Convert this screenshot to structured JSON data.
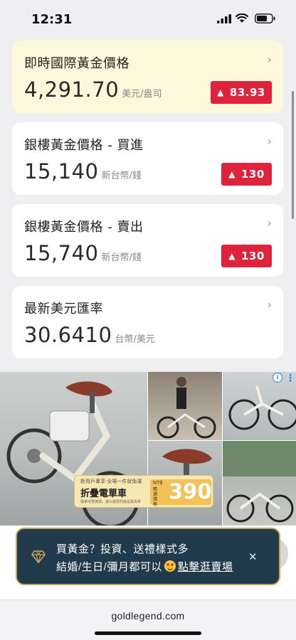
{
  "status_bar": {
    "time": "12:31"
  },
  "cards": [
    {
      "title": "即時國際黃金價格",
      "value": "4,291.70",
      "unit": "美元/盎司",
      "change": "83.93",
      "direction": "up"
    },
    {
      "title": "銀樓黃金價格 - 買進",
      "value": "15,140",
      "unit": "新台幣/錢",
      "change": "130",
      "direction": "up"
    },
    {
      "title": "銀樓黃金價格 - 賣出",
      "value": "15,740",
      "unit": "新台幣/錢",
      "change": "130",
      "direction": "up"
    },
    {
      "title": "最新美元匯率",
      "value": "30.6410",
      "unit": "台幣/美元"
    }
  ],
  "ad": {
    "tagline": "新用戶專享·全場一件就免運",
    "headline": "折疊電單車",
    "fine_print": "隨車可搭捷運，讓以最便利就是最為準",
    "currency": "NT$",
    "price_caption": "精選價格",
    "price": "390",
    "info_icon": "info-icon",
    "more_icon": "kebab-icon"
  },
  "toast": {
    "line1": "買黃金？投資、送禮樣式多",
    "line2_prefix": "結婚/生日/彌月都可以",
    "link": "點擊逛賣場",
    "close": "✕"
  },
  "browser": {
    "url": "goldlegend.com"
  },
  "colors": {
    "up_badge": "#e0233c",
    "gold_card": "#fdf8dc",
    "toast_bg": "#213b4d",
    "toast_border": "#c9a657"
  }
}
